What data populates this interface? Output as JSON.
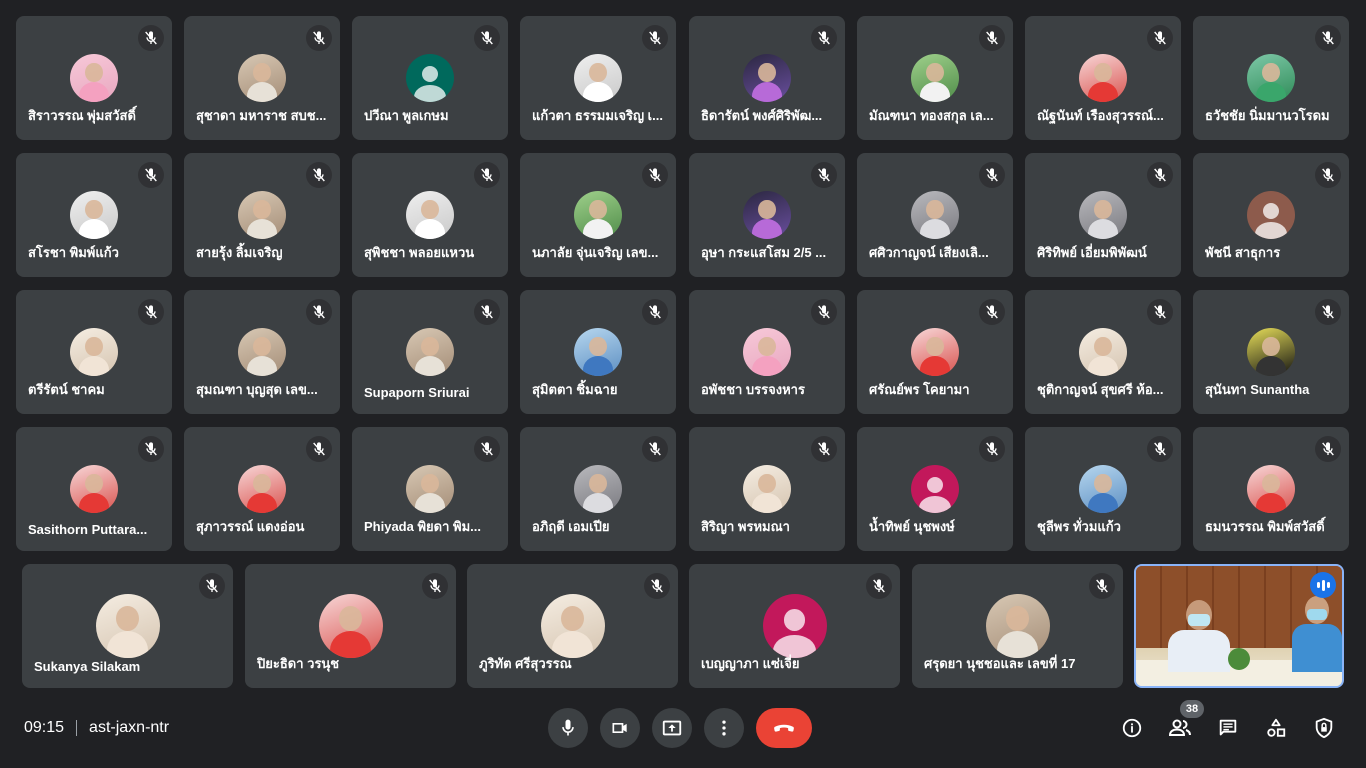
{
  "meeting": {
    "time": "09:15",
    "code": "ast-jaxn-ntr",
    "participant_count": "38"
  },
  "participants": [
    {
      "name": "สิราวรรณ พุ่มสวัสดิ์",
      "muted": true,
      "avatar": "photo-pink"
    },
    {
      "name": "สุชาดา มหาราช สบช...",
      "muted": true,
      "avatar": "photo-beige"
    },
    {
      "name": "ปวีณา พูลเกษม",
      "muted": true,
      "avatar": "placeholder-teal"
    },
    {
      "name": "แก้วตา ธรรมมเจริญ เ...",
      "muted": true,
      "avatar": "photo-white"
    },
    {
      "name": "ธิดารัตน์ พงศ์ศิริพัฒ...",
      "muted": true,
      "avatar": "photo-dark"
    },
    {
      "name": "มัณฑนา ทองสกุล เล...",
      "muted": true,
      "avatar": "photo-green"
    },
    {
      "name": "ณัฐนันท์ เรืองสุวรรณ์...",
      "muted": true,
      "avatar": "photo-red"
    },
    {
      "name": "ธวัชชัย นิ่มมานวโรดม",
      "muted": true,
      "avatar": "photo-greenface"
    },
    {
      "name": "สโรชา พิมพ์แก้ว",
      "muted": true,
      "avatar": "photo-white"
    },
    {
      "name": "สายรุ้ง ลิ้มเจริญ",
      "muted": true,
      "avatar": "photo-beige"
    },
    {
      "name": "สุพิชชา พลอยแหวน",
      "muted": true,
      "avatar": "photo-white"
    },
    {
      "name": "นภาลัย จุ่นเจริญ เลข...",
      "muted": true,
      "avatar": "photo-green"
    },
    {
      "name": "อุษา กระแสโสม 2/5 ...",
      "muted": true,
      "avatar": "photo-dark"
    },
    {
      "name": "ศศิวกาญจน์ เสียงเลิ...",
      "muted": true,
      "avatar": "photo-grey"
    },
    {
      "name": "ศิริทิพย์ เอี่ยมพิพัฒน์",
      "muted": true,
      "avatar": "photo-grey"
    },
    {
      "name": "พัชนี สาธุการ",
      "muted": true,
      "avatar": "placeholder-brown"
    },
    {
      "name": "ตรีรัตน์ ชาคม",
      "muted": true,
      "avatar": "photo-light"
    },
    {
      "name": "สุมณฑา บุญสุด เลข...",
      "muted": true,
      "avatar": "photo-beige"
    },
    {
      "name": "Supaporn Sriurai",
      "muted": true,
      "avatar": "photo-beige"
    },
    {
      "name": "สุมิตตา ชิ้มฉาย",
      "muted": true,
      "avatar": "photo-blue"
    },
    {
      "name": "อพัชชา บรรจงหาร",
      "muted": true,
      "avatar": "photo-pink"
    },
    {
      "name": "ศรัณย์พร โคยามา",
      "muted": true,
      "avatar": "photo-red"
    },
    {
      "name": "ชุติกาญจน์ สุขศรี ห้อ...",
      "muted": true,
      "avatar": "photo-light"
    },
    {
      "name": "สุนันทา Sunantha",
      "muted": true,
      "avatar": "photo-yellow"
    },
    {
      "name": "Sasithorn Puttara...",
      "muted": true,
      "avatar": "photo-red"
    },
    {
      "name": "สุภาวรรณ์ แดงอ่อน",
      "muted": true,
      "avatar": "photo-red"
    },
    {
      "name": "Phiyada พิยดา พิม...",
      "muted": true,
      "avatar": "photo-beige"
    },
    {
      "name": "อภิฤดี เอมเปีย",
      "muted": true,
      "avatar": "photo-grey"
    },
    {
      "name": "สิริญา พรหมณา",
      "muted": true,
      "avatar": "photo-light"
    },
    {
      "name": "น้ำทิพย์ นุชพงษ์",
      "muted": true,
      "avatar": "placeholder-magenta"
    },
    {
      "name": "ชุลีพร ทั่วมแก้ว",
      "muted": true,
      "avatar": "photo-blue"
    },
    {
      "name": "ธมนวรรณ พิมพ์สวัสดิ์",
      "muted": true,
      "avatar": "photo-red"
    },
    {
      "name": "Sukanya Silakam",
      "muted": true,
      "avatar": "photo-light"
    },
    {
      "name": "ปิยะธิดา วรนุช",
      "muted": true,
      "avatar": "photo-red"
    },
    {
      "name": "ภูริทัต ศรีสุวรรณ",
      "muted": true,
      "avatar": "photo-light"
    },
    {
      "name": "เบญญาภา แซ่เจี่ย",
      "muted": true,
      "avatar": "placeholder-magenta"
    },
    {
      "name": "ศรุดยา นุชชอและ เลขที่ 17",
      "muted": true,
      "avatar": "photo-beige"
    }
  ],
  "controls": {
    "mic": "mic-icon",
    "camera": "camera-icon",
    "present": "present-screen-icon",
    "more": "more-options-icon",
    "leave": "end-call-icon"
  },
  "side_controls": [
    "info-icon",
    "people-icon",
    "chat-icon",
    "activities-icon",
    "host-controls-icon"
  ],
  "colors": {
    "background": "#202124",
    "tile": "#3c4043",
    "end_call": "#ea4335",
    "speaking": "#1a73e8",
    "active_border": "#8ab4f8"
  }
}
